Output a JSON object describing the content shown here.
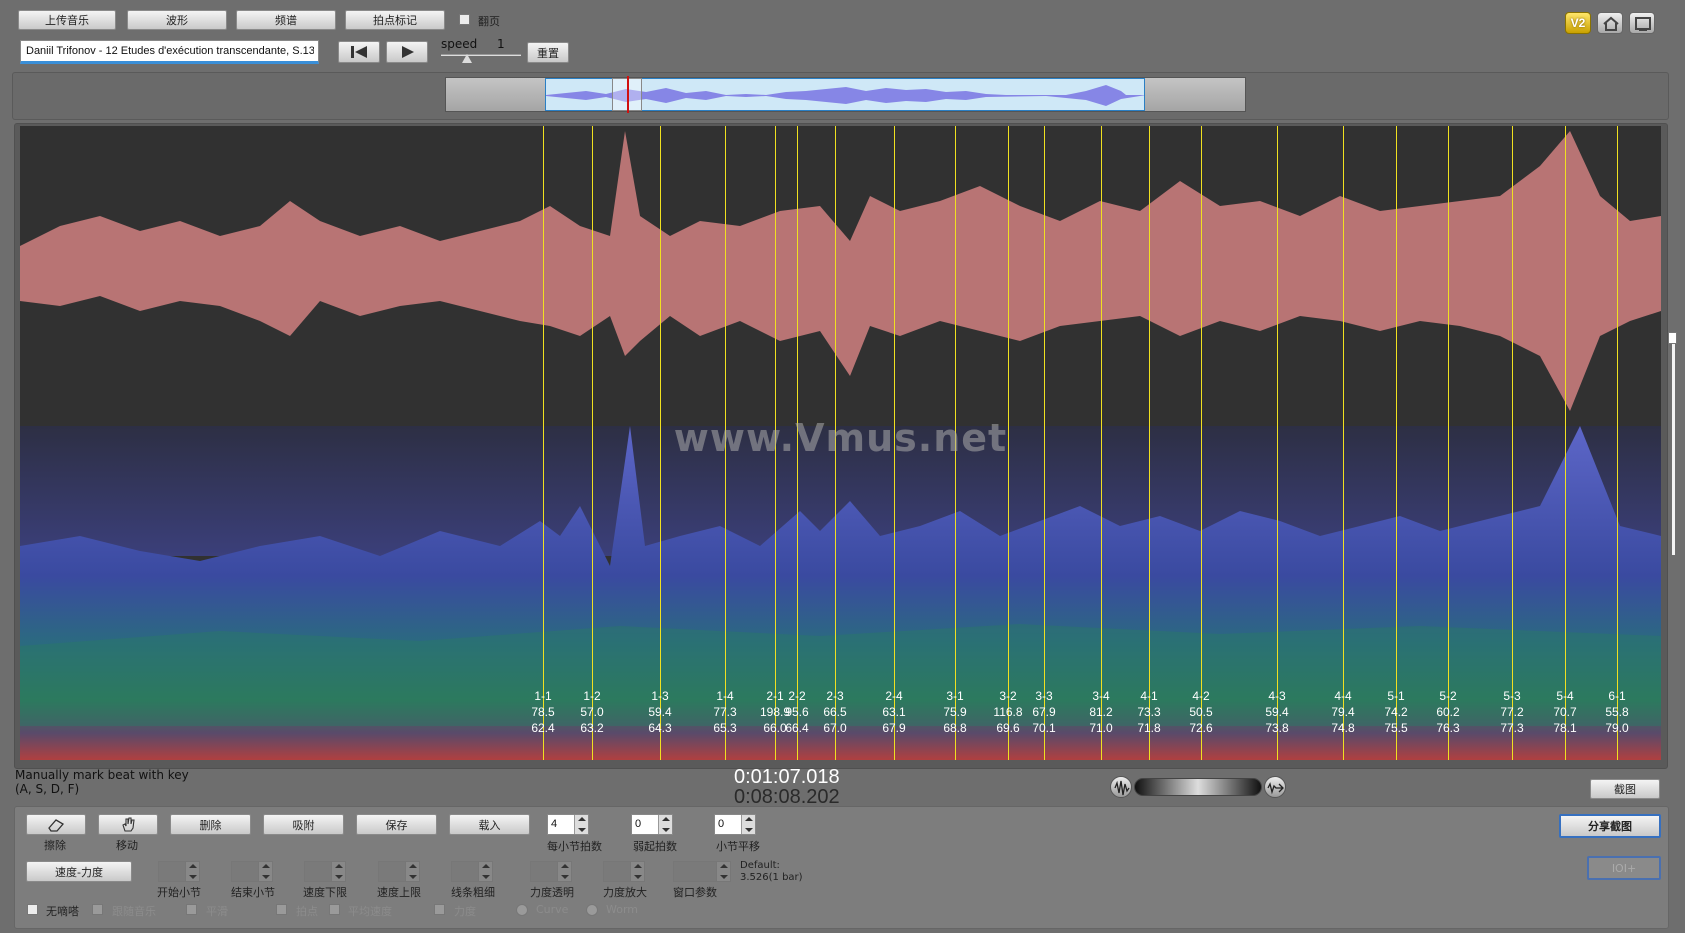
{
  "toolbar": {
    "upload": "上传音乐",
    "waveform": "波形",
    "spectrum": "频谱",
    "beat_mark": "拍点标记",
    "page_flip_label": "翻页",
    "v2": "V2"
  },
  "track": {
    "title": "Daniil Trifonov - 12 Etudes d'exécution transcendante, S.13",
    "speed_label": "speed",
    "speed_value": "1",
    "reset": "重置"
  },
  "spectrum": {
    "watermark": "www.Vmus.net",
    "markers": [
      {
        "label": "1-1",
        "tempo": "78.5",
        "avg": "62.4"
      },
      {
        "label": "1-2",
        "tempo": "57.0",
        "avg": "63.2"
      },
      {
        "label": "1-3",
        "tempo": "59.4",
        "avg": "64.3"
      },
      {
        "label": "1-4",
        "tempo": "77.3",
        "avg": "65.3"
      },
      {
        "label": "2-1",
        "tempo": "198.9",
        "avg": "66.0"
      },
      {
        "label": "2-2",
        "tempo": "95.6",
        "avg": "66.4"
      },
      {
        "label": "2-3",
        "tempo": "66.5",
        "avg": "67.0"
      },
      {
        "label": "2-4",
        "tempo": "63.1",
        "avg": "67.9"
      },
      {
        "label": "3-1",
        "tempo": "75.9",
        "avg": "68.8"
      },
      {
        "label": "3-2",
        "tempo": "116.8",
        "avg": "69.6"
      },
      {
        "label": "3-3",
        "tempo": "67.9",
        "avg": "70.1"
      },
      {
        "label": "3-4",
        "tempo": "81.2",
        "avg": "71.0"
      },
      {
        "label": "4-1",
        "tempo": "73.3",
        "avg": "71.8"
      },
      {
        "label": "4-2",
        "tempo": "50.5",
        "avg": "72.6"
      },
      {
        "label": "4-3",
        "tempo": "59.4",
        "avg": "73.8"
      },
      {
        "label": "4-4",
        "tempo": "79.4",
        "avg": "74.8"
      },
      {
        "label": "5-1",
        "tempo": "74.2",
        "avg": "75.5"
      },
      {
        "label": "5-2",
        "tempo": "60.2",
        "avg": "76.3"
      },
      {
        "label": "5-3",
        "tempo": "77.2",
        "avg": "77.3"
      },
      {
        "label": "5-4",
        "tempo": "70.7",
        "avg": "78.1"
      },
      {
        "label": "6-1",
        "tempo": "55.8",
        "avg": "79.0"
      }
    ]
  },
  "status": {
    "hint_line1": "Manually mark beat with key",
    "hint_line2": "(A, S, D, F)",
    "current_time": "0:01:07.018",
    "total_time": "0:08:08.202",
    "screenshot": "截图"
  },
  "tools": {
    "erase": "擦除",
    "move": "移动",
    "delete": "删除",
    "snap": "吸附",
    "save": "保存",
    "load": "载入",
    "beats_per_bar_label": "每小节拍数",
    "beats_per_bar": "4",
    "pickup_label": "弱起拍数",
    "pickup": "0",
    "bar_shift_label": "小节平移",
    "bar_shift": "0",
    "share_screenshot": "分享截图",
    "ioi": "IOI+",
    "tempo_dynamics": "速度-力度",
    "start_bar": "开始小节",
    "end_bar": "结束小节",
    "tempo_lower": "速度下限",
    "tempo_upper": "速度上限",
    "line_thickness": "线条粗细",
    "dynamics_opacity": "力度透明",
    "dynamics_zoom": "力度放大",
    "window_param": "窗口参数",
    "default_label": "Default:",
    "default_value": "3.526(1 bar)",
    "mute": "无嘀嗒",
    "follow_music": "跟随音乐",
    "smooth": "平滑",
    "beat_points": "拍点",
    "avg_tempo": "平均速度",
    "dynamics": "力度",
    "curve": "Curve",
    "worm": "Worm"
  }
}
